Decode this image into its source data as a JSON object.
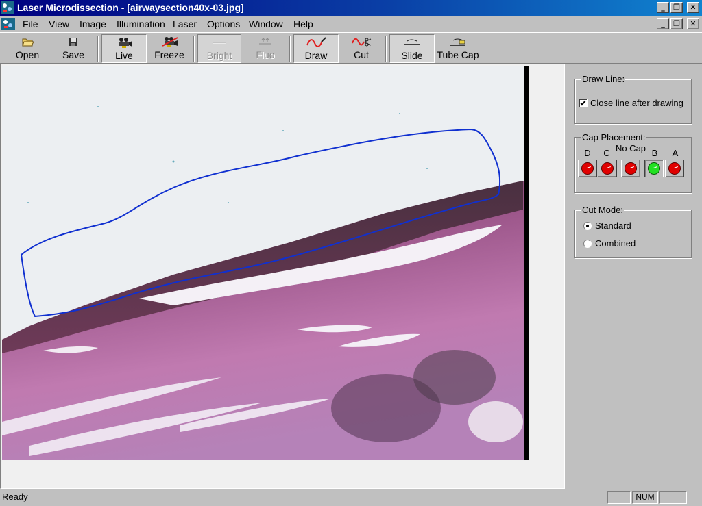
{
  "window": {
    "title": "Laser Microdissection - [airwaysection40x-03.jpg]",
    "controls": {
      "minimize": "_",
      "restore": "❐",
      "close": "✕"
    }
  },
  "menu": [
    "File",
    "View",
    "Image",
    "Illumination",
    "Laser",
    "Options",
    "Window",
    "Help"
  ],
  "toolbar": {
    "open": "Open",
    "save": "Save",
    "live": "Live",
    "freeze": "Freeze",
    "bright": "Bright",
    "fluo": "Fluo",
    "draw": "Draw",
    "cut": "Cut",
    "slide": "Slide",
    "tube_cap": "Tube Cap"
  },
  "draw_line": {
    "title": "Draw Line:",
    "close_line_label": "Close line after drawing",
    "close_line_checked": true
  },
  "cap_placement": {
    "title": "Cap Placement:",
    "caps": [
      {
        "label": "D",
        "state": "red"
      },
      {
        "label": "C",
        "state": "red"
      },
      {
        "label": "No Cap",
        "state": "red"
      },
      {
        "label": "B",
        "state": "green"
      },
      {
        "label": "A",
        "state": "red"
      }
    ]
  },
  "cut_mode": {
    "title": "Cut Mode:",
    "options": [
      "Standard",
      "Combined"
    ],
    "selected": "Standard"
  },
  "status": {
    "text": "Ready",
    "num": "NUM"
  },
  "colors": {
    "title_bar": "#000080",
    "cap_red": "#e00000",
    "cap_green": "#22e022",
    "trace_line": "#1030d0"
  }
}
